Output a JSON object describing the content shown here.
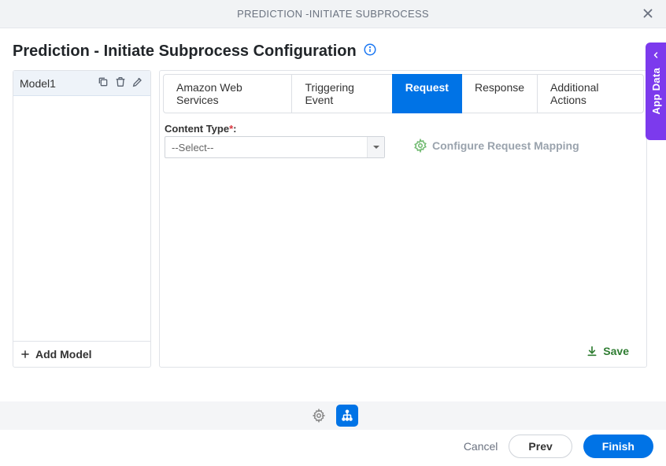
{
  "modal": {
    "title": "PREDICTION -INITIATE SUBPROCESS"
  },
  "page": {
    "title": "Prediction - Initiate Subprocess Configuration"
  },
  "sidebar": {
    "models": [
      "Model1"
    ],
    "add_label": "Add Model"
  },
  "tabs": {
    "items": [
      "Amazon Web Services",
      "Triggering Event",
      "Request",
      "Response",
      "Additional Actions"
    ],
    "active_index": 2
  },
  "form": {
    "content_type_label": "Content Type",
    "content_type_required": "*",
    "content_type_colon": ":",
    "content_type_value": "--Select--",
    "configure_mapping_label": "Configure Request Mapping"
  },
  "actions": {
    "save": "Save"
  },
  "app_data_tab": {
    "label": "App Data"
  },
  "footer": {
    "cancel": "Cancel",
    "prev": "Prev",
    "finish": "Finish"
  }
}
